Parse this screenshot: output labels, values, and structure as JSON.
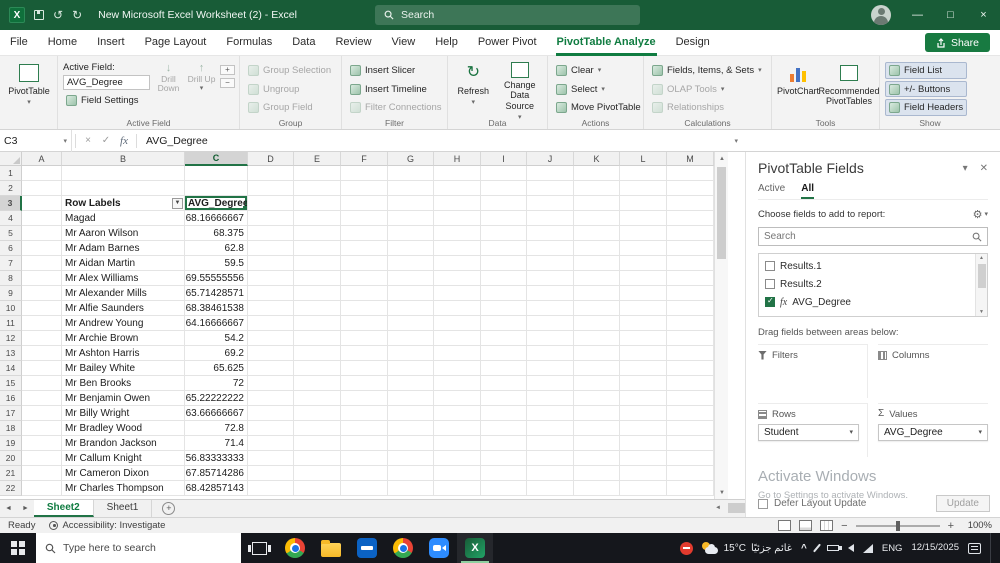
{
  "titlebar": {
    "title": "New Microsoft Excel Worksheet (2) - Excel",
    "search_placeholder": "Search"
  },
  "ribbon": {
    "tabs": [
      {
        "label": "File"
      },
      {
        "label": "Home"
      },
      {
        "label": "Insert"
      },
      {
        "label": "Page Layout"
      },
      {
        "label": "Formulas"
      },
      {
        "label": "Data"
      },
      {
        "label": "Review"
      },
      {
        "label": "View"
      },
      {
        "label": "Help"
      },
      {
        "label": "Power Pivot"
      },
      {
        "label": "PivotTable Analyze",
        "active": true
      },
      {
        "label": "Design"
      }
    ],
    "share_label": "Share",
    "pivottable_group": {
      "button_label": "PivotTable"
    },
    "active_field": {
      "title": "Active Field:",
      "value": "AVG_Degree",
      "field_settings": "Field Settings",
      "drill_down": "Drill Down",
      "drill_up": "Drill Up",
      "caption": "Active Field"
    },
    "group_group": {
      "caption": "Group",
      "items": [
        {
          "label": "Group Selection",
          "icon": "group-selection-icon",
          "disabled": true
        },
        {
          "label": "Ungroup",
          "icon": "ungroup-icon",
          "disabled": true
        },
        {
          "label": "Group Field",
          "icon": "group-field-icon",
          "disabled": true
        }
      ]
    },
    "filter_group": {
      "caption": "Filter",
      "items": [
        {
          "label": "Insert Slicer",
          "icon": "insert-slicer-icon"
        },
        {
          "label": "Insert Timeline",
          "icon": "insert-timeline-icon"
        },
        {
          "label": "Filter Connections",
          "icon": "filter-connections-icon",
          "disabled": true
        }
      ]
    },
    "data_group": {
      "caption": "Data",
      "refresh": "Refresh",
      "change_source": "Change Data Source"
    },
    "actions_group": {
      "caption": "Actions",
      "items": [
        {
          "label": "Clear",
          "icon": "clear-icon",
          "dropdown": true
        },
        {
          "label": "Select",
          "icon": "select-icon",
          "dropdown": true
        },
        {
          "label": "Move PivotTable",
          "icon": "move-pivottable-icon"
        }
      ]
    },
    "calculations_group": {
      "caption": "Calculations",
      "items": [
        {
          "label": "Fields, Items, & Sets",
          "icon": "fields-items-sets-icon",
          "dropdown": true
        },
        {
          "label": "OLAP Tools",
          "icon": "olap-tools-icon",
          "dropdown": true,
          "disabled": true
        },
        {
          "label": "Relationships",
          "icon": "relationships-icon",
          "disabled": true
        }
      ]
    },
    "tools_group": {
      "caption": "Tools",
      "pivotchart": "PivotChart",
      "recommended": "Recommended PivotTables"
    },
    "show_group": {
      "caption": "Show",
      "items": [
        {
          "label": "Field List",
          "icon": "field-list-icon",
          "active": true
        },
        {
          "label": "+/- Buttons",
          "icon": "plus-minus-buttons-icon",
          "active": true
        },
        {
          "label": "Field Headers",
          "icon": "field-headers-icon",
          "active": true
        }
      ]
    }
  },
  "formula_bar": {
    "name_box": "C3",
    "formula": "AVG_Degree"
  },
  "sheet": {
    "columns": [
      "A",
      "B",
      "C",
      "D",
      "E",
      "F",
      "G",
      "H",
      "I",
      "J",
      "K",
      "L",
      "M"
    ],
    "active_column": "C",
    "active_row": 3,
    "row_count": 22,
    "data_start_row": 4,
    "header_row": {
      "row_labels": "Row Labels",
      "values": "AVG_Degree"
    },
    "rows": [
      {
        "label": "Magad",
        "value": "68.16666667"
      },
      {
        "label": "Mr Aaron Wilson",
        "value": "68.375"
      },
      {
        "label": "Mr Adam Barnes",
        "value": "62.8"
      },
      {
        "label": "Mr Aidan Martin",
        "value": "59.5"
      },
      {
        "label": "Mr Alex Williams",
        "value": "69.55555556"
      },
      {
        "label": "Mr Alexander Mills",
        "value": "65.71428571"
      },
      {
        "label": "Mr Alfie Saunders",
        "value": "68.38461538"
      },
      {
        "label": "Mr Andrew Young",
        "value": "64.16666667"
      },
      {
        "label": "Mr Archie Brown",
        "value": "54.2"
      },
      {
        "label": "Mr Ashton Harris",
        "value": "69.2"
      },
      {
        "label": "Mr Bailey White",
        "value": "65.625"
      },
      {
        "label": "Mr Ben Brooks",
        "value": "72"
      },
      {
        "label": "Mr Benjamin Owen",
        "value": "65.22222222"
      },
      {
        "label": "Mr Billy Wright",
        "value": "63.66666667"
      },
      {
        "label": "Mr Bradley Wood",
        "value": "72.8"
      },
      {
        "label": "Mr Brandon Jackson",
        "value": "71.4"
      },
      {
        "label": "Mr Callum Knight",
        "value": "56.83333333"
      },
      {
        "label": "Mr Cameron Dixon",
        "value": "67.85714286"
      },
      {
        "label": "Mr Charles Thompson",
        "value": "68.42857143"
      }
    ]
  },
  "sheet_tabs": [
    {
      "name": "Sheet2",
      "active": true
    },
    {
      "name": "Sheet1"
    }
  ],
  "status_bar": {
    "ready": "Ready",
    "accessibility": "Accessibility: Investigate",
    "zoom": "100%"
  },
  "fields_pane": {
    "title": "PivotTable Fields",
    "tabs": [
      "Active",
      "All"
    ],
    "active_tab": "All",
    "choose_label": "Choose fields to add to report:",
    "search_placeholder": "Search",
    "fields": [
      {
        "name": "Results.1",
        "checked": false
      },
      {
        "name": "Results.2",
        "checked": false
      },
      {
        "name": "AVG_Degree",
        "checked": true,
        "fx": true
      }
    ],
    "drag_label": "Drag fields between areas below:",
    "areas": {
      "filters": {
        "title": "Filters",
        "items": []
      },
      "columns": {
        "title": "Columns",
        "items": []
      },
      "rows": {
        "title": "Rows",
        "items": [
          "Student"
        ]
      },
      "values": {
        "title": "Values",
        "items": [
          "AVG_Degree"
        ]
      }
    },
    "defer_label": "Defer Layout Update",
    "update_label": "Update",
    "watermark_line1": "Activate Windows",
    "watermark_line2": "Go to Settings to activate Windows."
  },
  "taskbar": {
    "search_placeholder": "Type here to search",
    "weather_temp": "15°C",
    "weather_desc": "غائم جزئيًا",
    "language": "ENG",
    "date": "12/15/2025"
  }
}
